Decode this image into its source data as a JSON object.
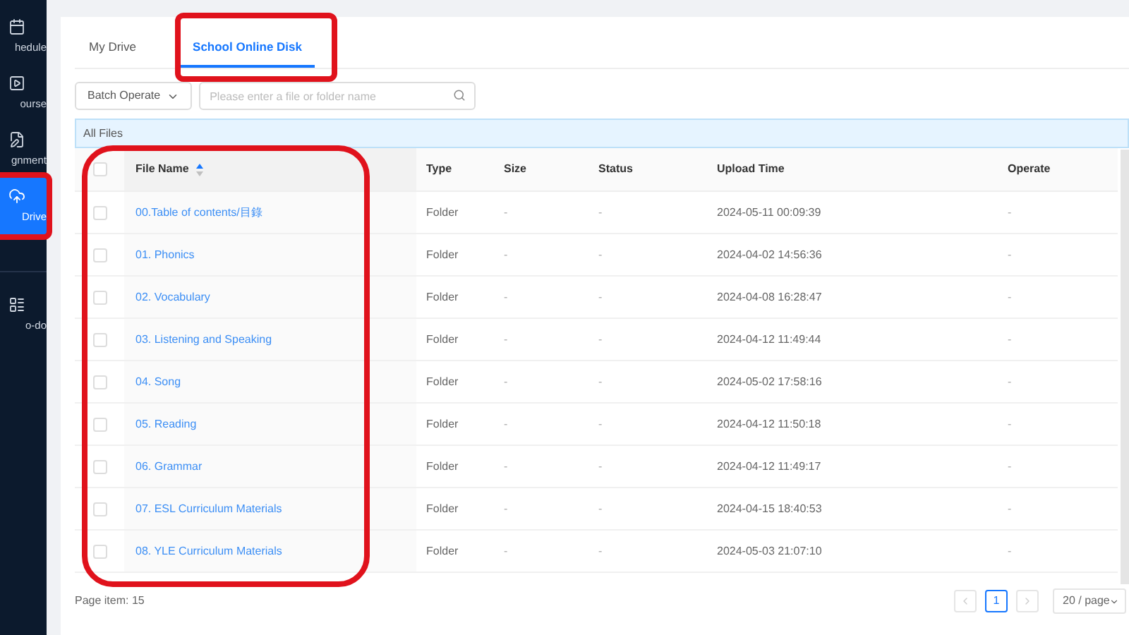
{
  "sidebar": {
    "items": [
      {
        "label": "hedule",
        "selected": false,
        "highlighted": false
      },
      {
        "label": "ourse",
        "selected": false,
        "highlighted": false
      },
      {
        "label": "gnment",
        "selected": false,
        "highlighted": false
      },
      {
        "label": "Drive",
        "selected": true,
        "highlighted": true
      },
      {
        "label": "o-do",
        "selected": false,
        "highlighted": false
      }
    ]
  },
  "tabs": [
    {
      "label": "My Drive",
      "selected": false,
      "highlighted": false
    },
    {
      "label": "School Online Disk",
      "selected": true,
      "highlighted": true
    }
  ],
  "toolbar": {
    "batch_button": "Batch Operate",
    "search": {
      "placeholder": "Please enter a file or folder name"
    }
  },
  "breadcrumb": "All Files",
  "table": {
    "all_checked": false,
    "columns": [
      {
        "label": "File Name",
        "sort_ascending": true,
        "highlighted": true
      },
      {
        "label": "Type",
        "highlighted": false
      },
      {
        "label": "Size",
        "highlighted": false
      },
      {
        "label": "Status",
        "highlighted": false
      },
      {
        "label": "Upload Time",
        "highlighted": false
      },
      {
        "label": "Operate",
        "highlighted": false
      }
    ],
    "rows": [
      {
        "checked": false,
        "name": "00.Table of contents/目錄",
        "type": "Folder",
        "size": "-",
        "status": "-",
        "upload_time": "2024-05-11 00:09:39",
        "operate": "-"
      },
      {
        "checked": false,
        "name": "01. Phonics",
        "type": "Folder",
        "size": "-",
        "status": "-",
        "upload_time": "2024-04-02 14:56:36",
        "operate": "-"
      },
      {
        "checked": false,
        "name": "02. Vocabulary",
        "type": "Folder",
        "size": "-",
        "status": "-",
        "upload_time": "2024-04-08 16:28:47",
        "operate": "-"
      },
      {
        "checked": false,
        "name": "03. Listening and Speaking",
        "type": "Folder",
        "size": "-",
        "status": "-",
        "upload_time": "2024-04-12 11:49:44",
        "operate": "-"
      },
      {
        "checked": false,
        "name": "04. Song",
        "type": "Folder",
        "size": "-",
        "status": "-",
        "upload_time": "2024-05-02 17:58:16",
        "operate": "-"
      },
      {
        "checked": false,
        "name": "05. Reading",
        "type": "Folder",
        "size": "-",
        "status": "-",
        "upload_time": "2024-04-12 11:50:18",
        "operate": "-"
      },
      {
        "checked": false,
        "name": "06. Grammar",
        "type": "Folder",
        "size": "-",
        "status": "-",
        "upload_time": "2024-04-12 11:49:17",
        "operate": "-"
      },
      {
        "checked": false,
        "name": "07. ESL Curriculum Materials",
        "type": "Folder",
        "size": "-",
        "status": "-",
        "upload_time": "2024-04-15 18:40:53",
        "operate": "-"
      },
      {
        "checked": false,
        "name": "08. YLE Curriculum Materials",
        "type": "Folder",
        "size": "-",
        "status": "-",
        "upload_time": "2024-05-03 21:07:10",
        "operate": "-"
      }
    ]
  },
  "footer": {
    "page_item": "Page item: 15",
    "pages": [
      {
        "label": "1",
        "selected": true
      }
    ],
    "page_size": "20 / page"
  }
}
